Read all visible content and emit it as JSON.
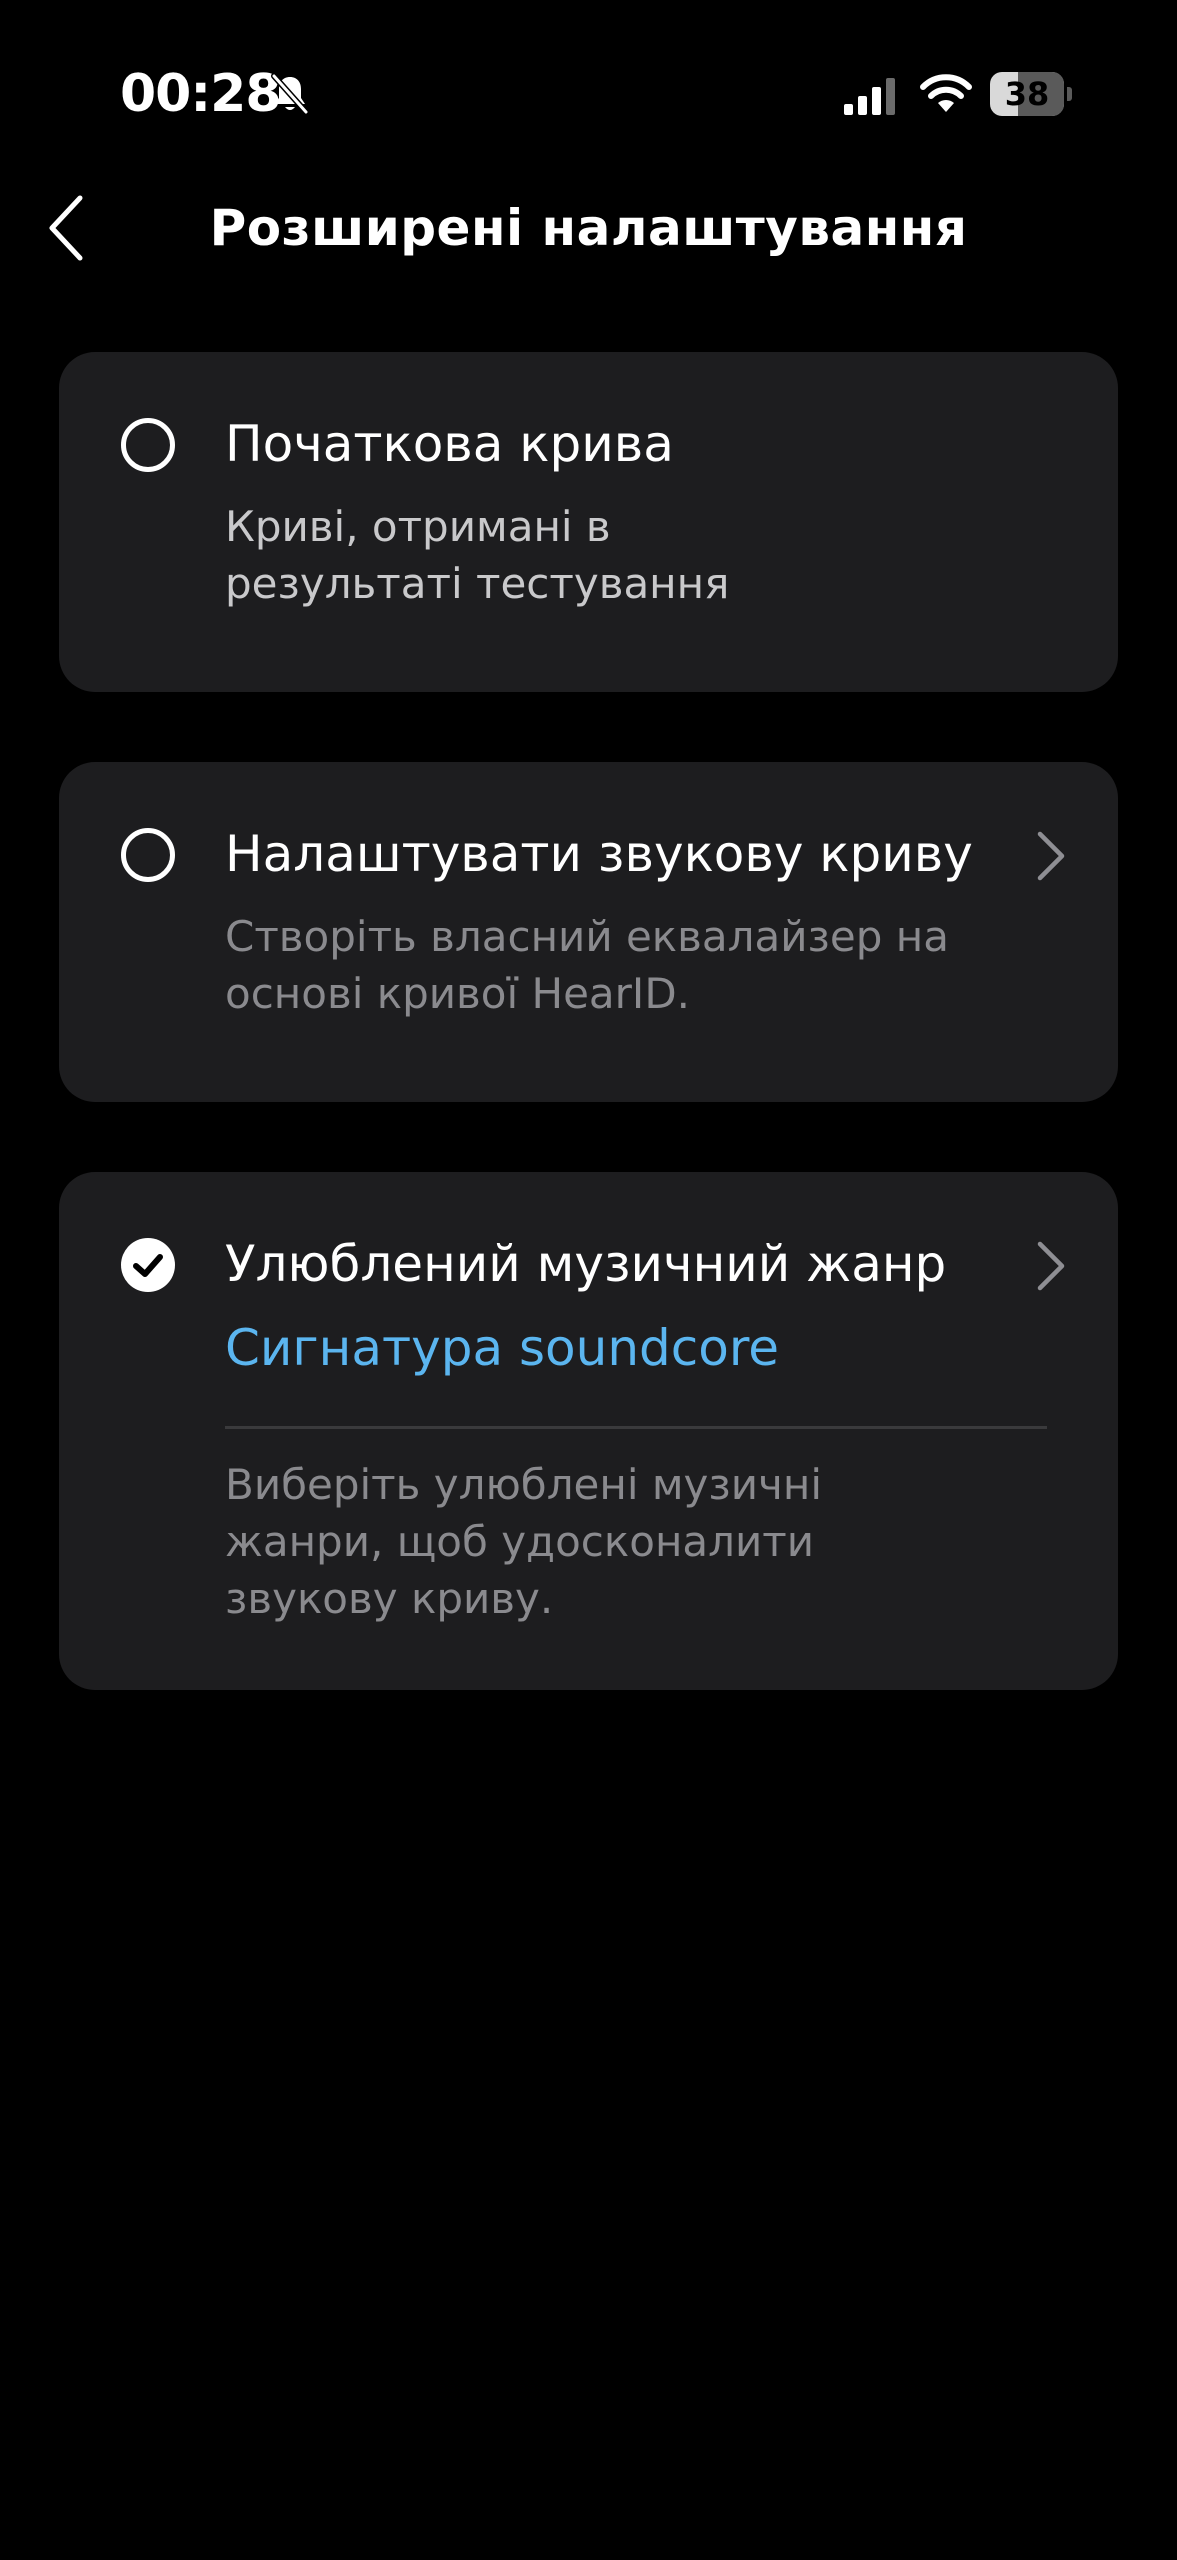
{
  "status_bar": {
    "time": "00:28",
    "battery_level": "38",
    "battery_fraction": 0.38,
    "icons": [
      "bell-slash-icon",
      "cellular-signal-icon",
      "wifi-icon",
      "battery-icon"
    ]
  },
  "header": {
    "title": "Розширені налаштування",
    "back_icon": "chevron-left-icon"
  },
  "options": [
    {
      "title": "Початкова крива",
      "description": "Криві, отримані в\nрезультаті тестування",
      "selected": false,
      "has_chevron": false
    },
    {
      "title": "Налаштувати звукову криву",
      "description": "Створіть власний еквалайзер на\nоснові кривої HearID.",
      "selected": false,
      "has_chevron": true
    },
    {
      "title": "Улюблений музичний жанр",
      "subtitle": "Сигнатура soundcore",
      "description": "Виберіть улюблені музичні\nжанри, щоб удосконалити\nзвукову криву.",
      "selected": true,
      "has_chevron": true
    }
  ],
  "colors": {
    "background": "#000000",
    "card": "#1d1d1f",
    "accent": "#5bb5ef",
    "text_primary": "#ffffff",
    "text_secondary": "#8a8a8e"
  }
}
